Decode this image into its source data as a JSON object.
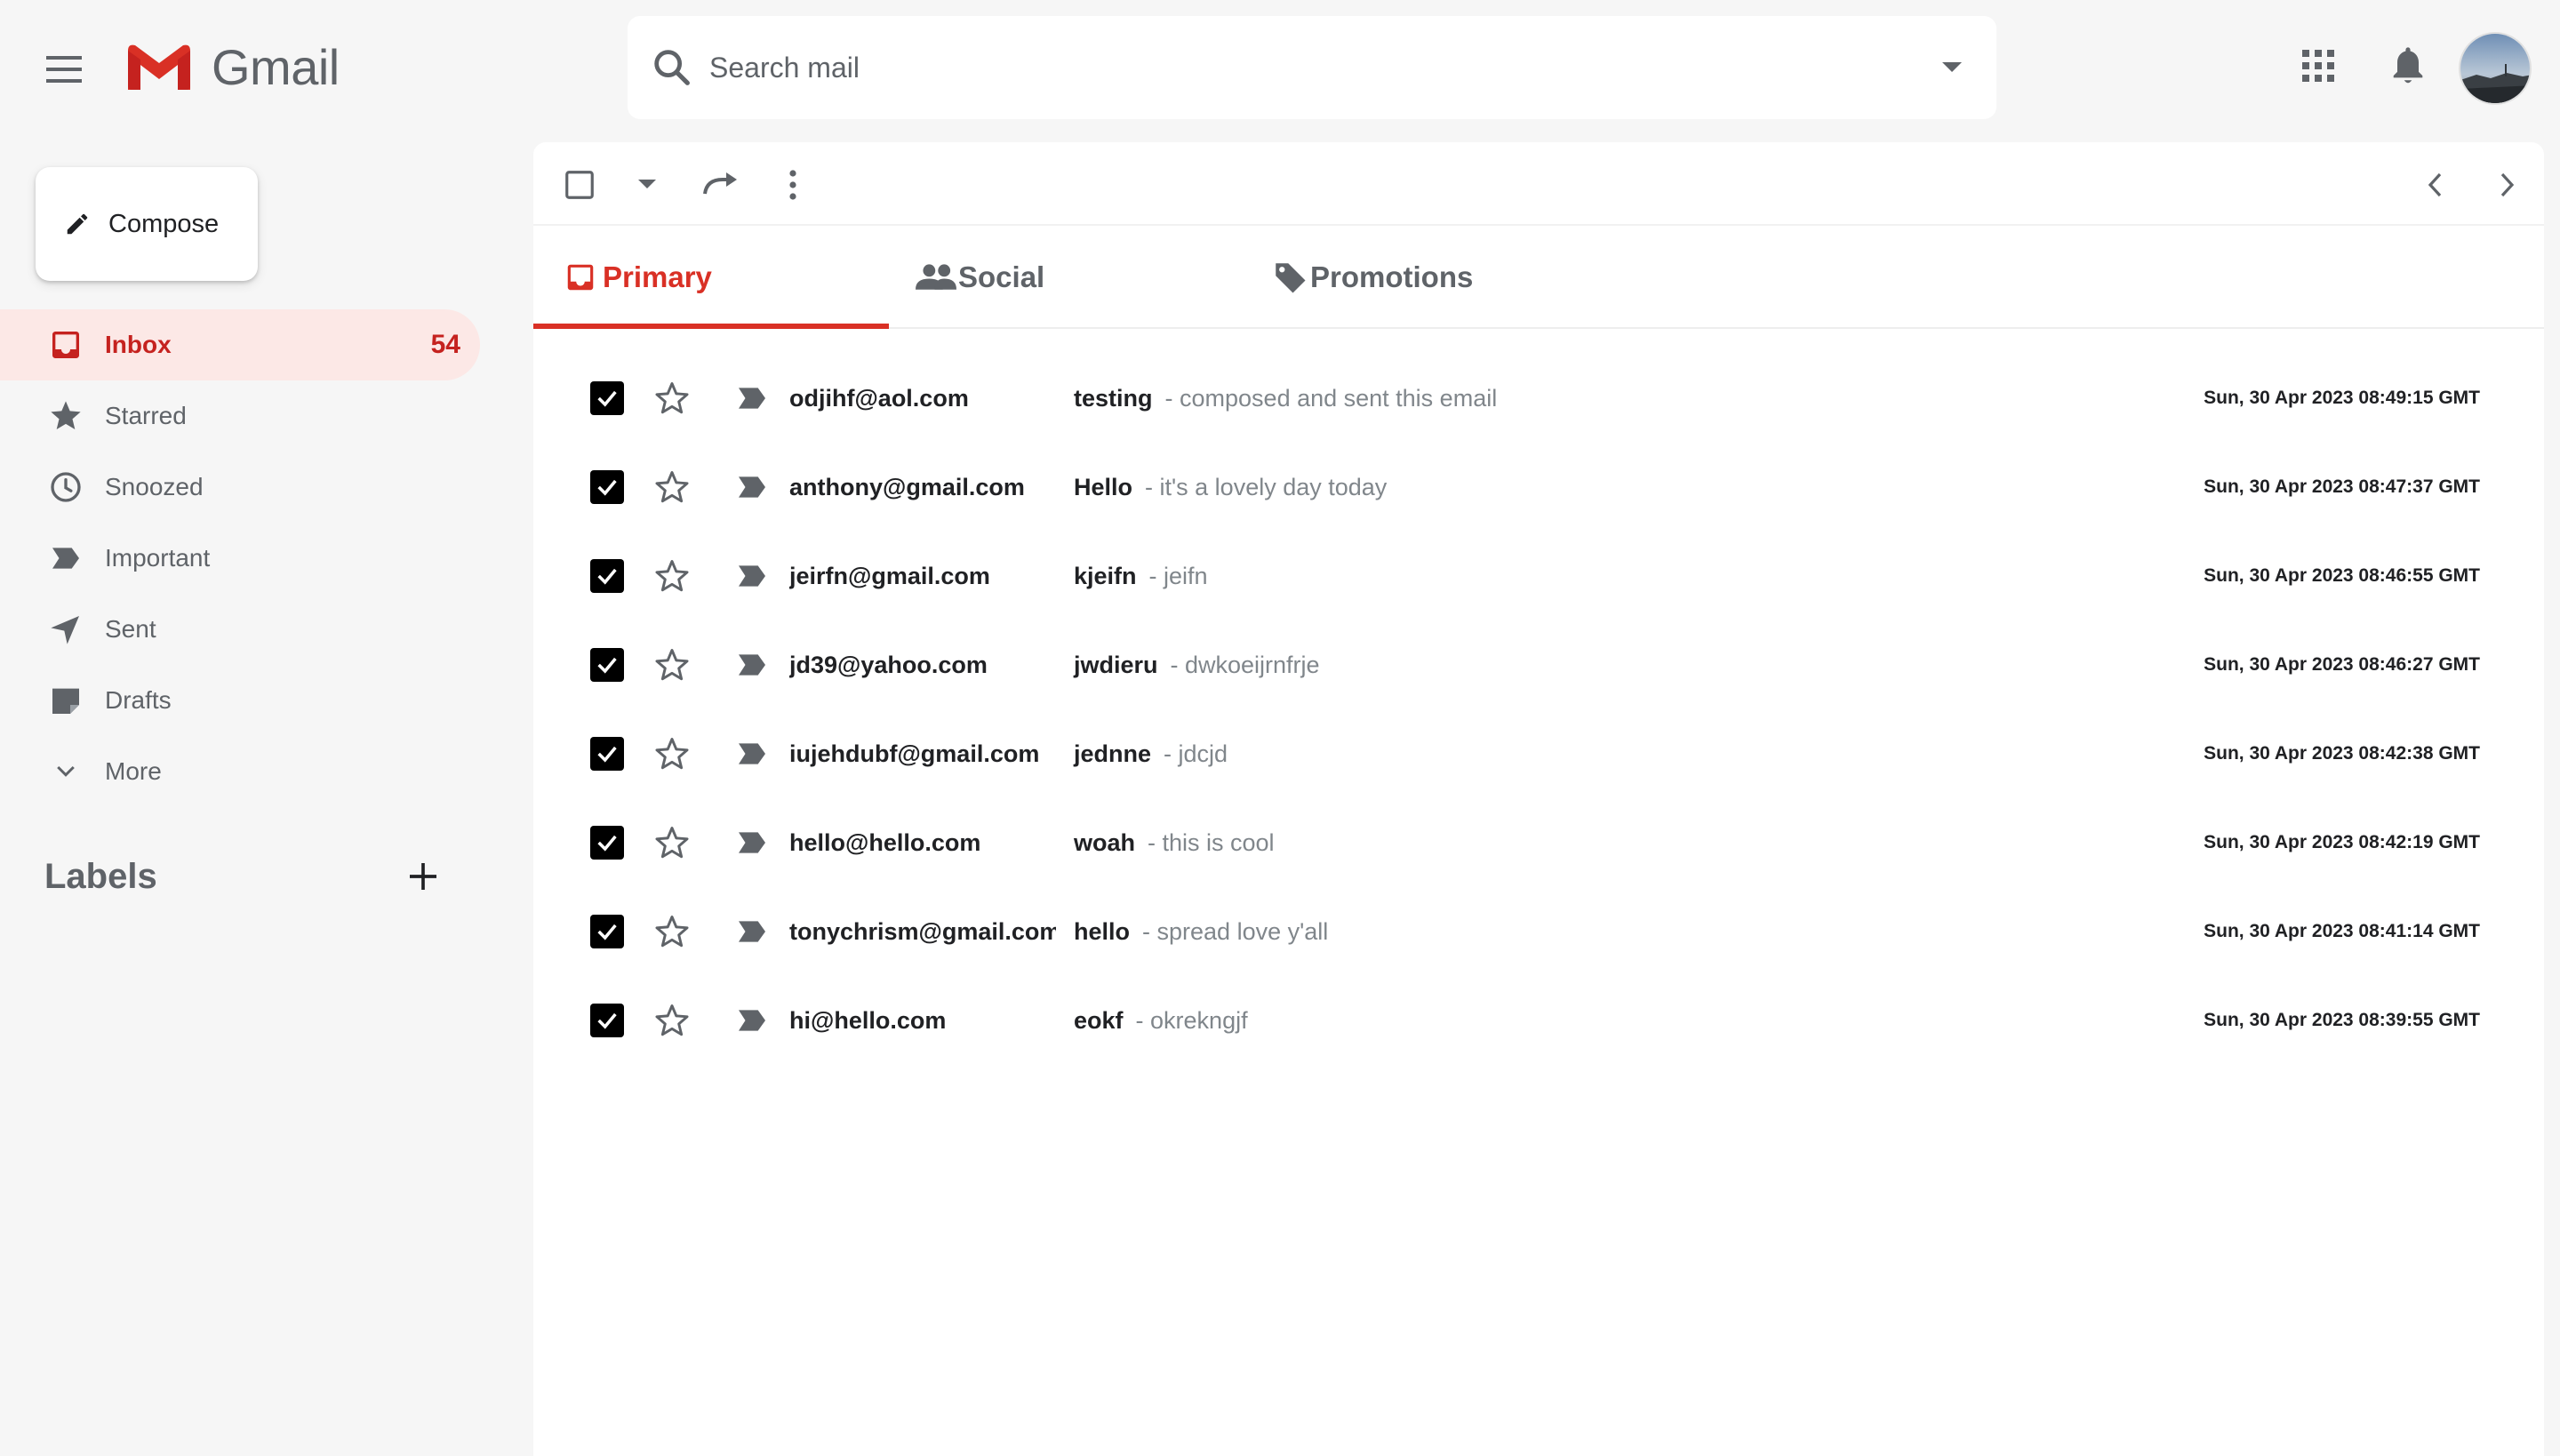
{
  "app": {
    "title": "Gmail"
  },
  "colors": {
    "brand_red": "#d93025",
    "active_bg": "#fce8e6",
    "muted": "#5f6368"
  },
  "search": {
    "placeholder": "Search mail",
    "value": ""
  },
  "header_icons": [
    "menu-icon",
    "apps-icon",
    "notifications-icon",
    "avatar"
  ],
  "sidebar": {
    "compose_label": "Compose",
    "items": [
      {
        "label": "Inbox",
        "icon": "inbox-icon",
        "count": "54",
        "active": true
      },
      {
        "label": "Starred",
        "icon": "star-icon"
      },
      {
        "label": "Snoozed",
        "icon": "clock-icon"
      },
      {
        "label": "Important",
        "icon": "important-icon"
      },
      {
        "label": "Sent",
        "icon": "send-icon"
      },
      {
        "label": "Drafts",
        "icon": "draft-icon"
      },
      {
        "label": "More",
        "icon": "chevron-down-icon"
      }
    ],
    "labels_heading": "Labels"
  },
  "tabs": [
    {
      "label": "Primary",
      "icon": "inbox-icon",
      "active": true
    },
    {
      "label": "Social",
      "icon": "people-icon"
    },
    {
      "label": "Promotions",
      "icon": "tag-icon"
    }
  ],
  "emails": [
    {
      "sender": "odjihf@aol.com",
      "subject": "testing",
      "snippet": "- composed and sent this email",
      "date": "Sun, 30 Apr 2023 08:49:15 GMT",
      "checked": true
    },
    {
      "sender": "anthony@gmail.com",
      "subject": "Hello",
      "snippet": "- it's a lovely day today",
      "date": "Sun, 30 Apr 2023 08:47:37 GMT",
      "checked": true
    },
    {
      "sender": "jeirfn@gmail.com",
      "subject": "kjeifn",
      "snippet": "- jeifn",
      "date": "Sun, 30 Apr 2023 08:46:55 GMT",
      "checked": true
    },
    {
      "sender": "jd39@yahoo.com",
      "subject": "jwdieru",
      "snippet": "- dwkoeijrnfrje",
      "date": "Sun, 30 Apr 2023 08:46:27 GMT",
      "checked": true
    },
    {
      "sender": "iujehdubf@gmail.com",
      "subject": "jednne",
      "snippet": "- jdcjd",
      "date": "Sun, 30 Apr 2023 08:42:38 GMT",
      "checked": true
    },
    {
      "sender": "hello@hello.com",
      "subject": "woah",
      "snippet": "- this is cool",
      "date": "Sun, 30 Apr 2023 08:42:19 GMT",
      "checked": true
    },
    {
      "sender": "tonychrism@gmail.com",
      "subject": "hello",
      "snippet": "- spread love y'all",
      "date": "Sun, 30 Apr 2023 08:41:14 GMT",
      "checked": true
    },
    {
      "sender": "hi@hello.com",
      "subject": "eokf",
      "snippet": "- okrekngjf",
      "date": "Sun, 30 Apr 2023 08:39:55 GMT",
      "checked": true
    }
  ]
}
